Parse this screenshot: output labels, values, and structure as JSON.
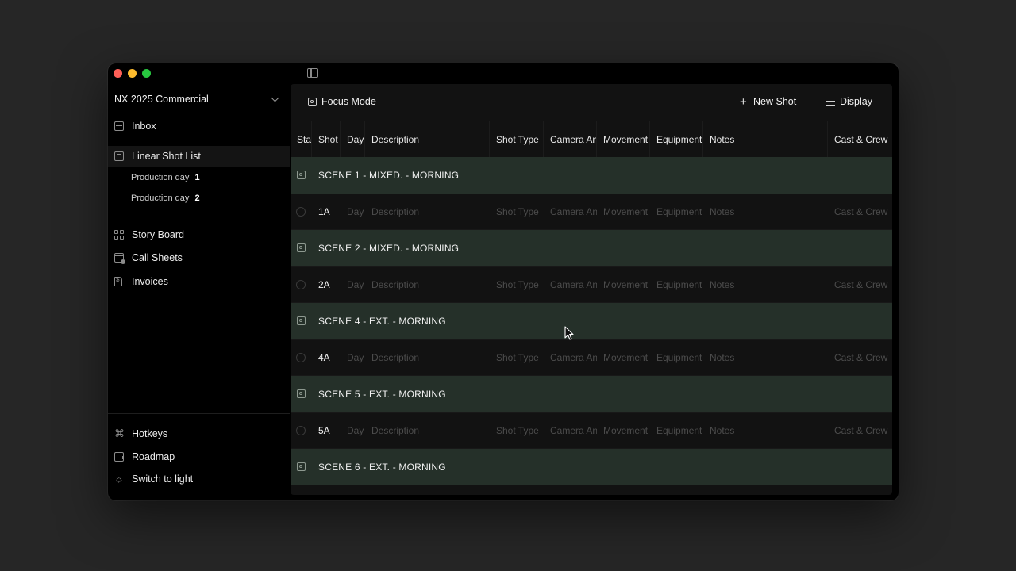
{
  "sidebar": {
    "workspace": "NX 2025 Commercial",
    "inbox": "Inbox",
    "linear_shot_list": "Linear Shot List",
    "production_days": [
      {
        "prefix": "Production day",
        "num": "1"
      },
      {
        "prefix": "Production day",
        "num": "2"
      }
    ],
    "story_board": "Story Board",
    "call_sheets": "Call Sheets",
    "invoices": "Invoices",
    "hotkeys": "Hotkeys",
    "roadmap": "Roadmap",
    "switch_theme": "Switch to light"
  },
  "toolbar": {
    "focus_mode": "Focus Mode",
    "new_shot": "New Shot",
    "display": "Display"
  },
  "table": {
    "headers": {
      "status": "Status",
      "shot": "Shot",
      "day": "Day",
      "description": "Description",
      "shot_type": "Shot Type",
      "camera": "Camera Angle",
      "movement": "Movement",
      "equipment": "Equipment",
      "notes": "Notes",
      "cast": "Cast & Crew"
    },
    "placeholders": {
      "day": "Day",
      "description": "Description",
      "shot_type": "Shot Type",
      "camera": "Camera Angle",
      "movement": "Movement",
      "equipment": "Equipment",
      "notes": "Notes",
      "cast": "Cast & Crew"
    },
    "scenes": [
      {
        "title": "SCENE 1 - MIXED. - MORNING",
        "shot": "1A"
      },
      {
        "title": "SCENE 2 - MIXED. - MORNING",
        "shot": "2A"
      },
      {
        "title": "SCENE 4 - EXT. - MORNING",
        "shot": "4A"
      },
      {
        "title": "SCENE 5 - EXT. - MORNING",
        "shot": "5A"
      },
      {
        "title": "SCENE 6 - EXT. - MORNING",
        "shot": null
      }
    ]
  },
  "colors": {
    "scene_row": "#253029",
    "panel": "#121212",
    "sidebar": "#000000"
  }
}
